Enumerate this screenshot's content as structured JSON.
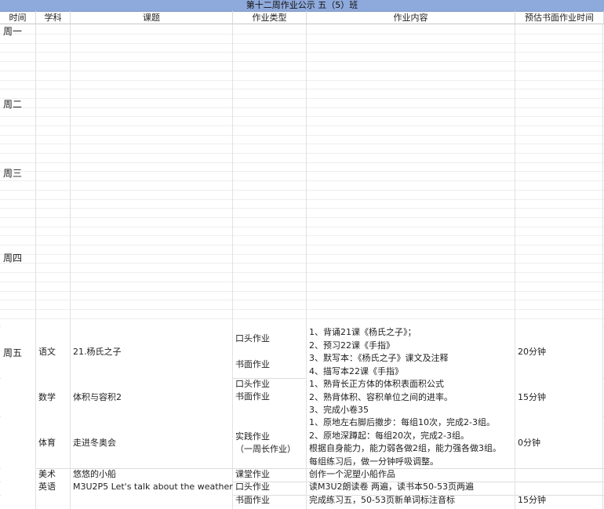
{
  "title": "第十二周作业公示 五（5）班",
  "headers": {
    "time": "时间",
    "subject": "学科",
    "topic": "课题",
    "type": "作业类型",
    "content": "作业内容",
    "estimate": "预估书面作业时间"
  },
  "days": {
    "mon": "周一",
    "tue": "周二",
    "wed": "周三",
    "thu": "周四",
    "fri": "周五"
  },
  "friday": {
    "chinese": {
      "subject": "语文",
      "topic": "21.杨氏之子",
      "type_oral": "口头作业",
      "type_written": "书面作业",
      "content": [
        "1、背诵21课《杨氏之子》；",
        "2、预习22课《手指》",
        "3、默写本：《杨氏之子》课文及注释",
        "4、描写本22课《手指》"
      ],
      "time": "20分钟"
    },
    "math": {
      "subject": "数学",
      "topic": "体积与容积2",
      "type_oral": "口头作业",
      "type_written": "书面作业",
      "content": [
        "1、熟背长正方体的体积表面积公式",
        "2、熟背体积、容积单位之间的进率。",
        "3、完成小卷35"
      ],
      "time": "15分钟"
    },
    "pe": {
      "subject": "体育",
      "topic": "走进冬奥会",
      "type_line1": "实践作业",
      "type_line2": "（一周长作业）",
      "content": [
        "1、原地左右脚后撤步：每组10次，完成2-3组。",
        "2、原地深蹲起：每组20次，完成2-3组。",
        "根据自身能力，能力弱各做2组，能力强各做3组。",
        "每组练习后，做一分钟呼吸调整。"
      ],
      "time": "0分钟"
    },
    "art": {
      "subject": "美术",
      "topic": "悠悠的小船",
      "type": "课堂作业",
      "content": "创作一个泥塑小船作品"
    },
    "english": {
      "subject": "英语",
      "topic": "M3U2P5 Let's talk about the weather",
      "type_oral": "口头作业",
      "content_oral": "读M3U2朗读卷 两遍，读书本50-53页两遍",
      "type_written": "书面作业",
      "content_written": "完成练习五，50-53页新单词标注音标",
      "time": "15分钟"
    }
  }
}
